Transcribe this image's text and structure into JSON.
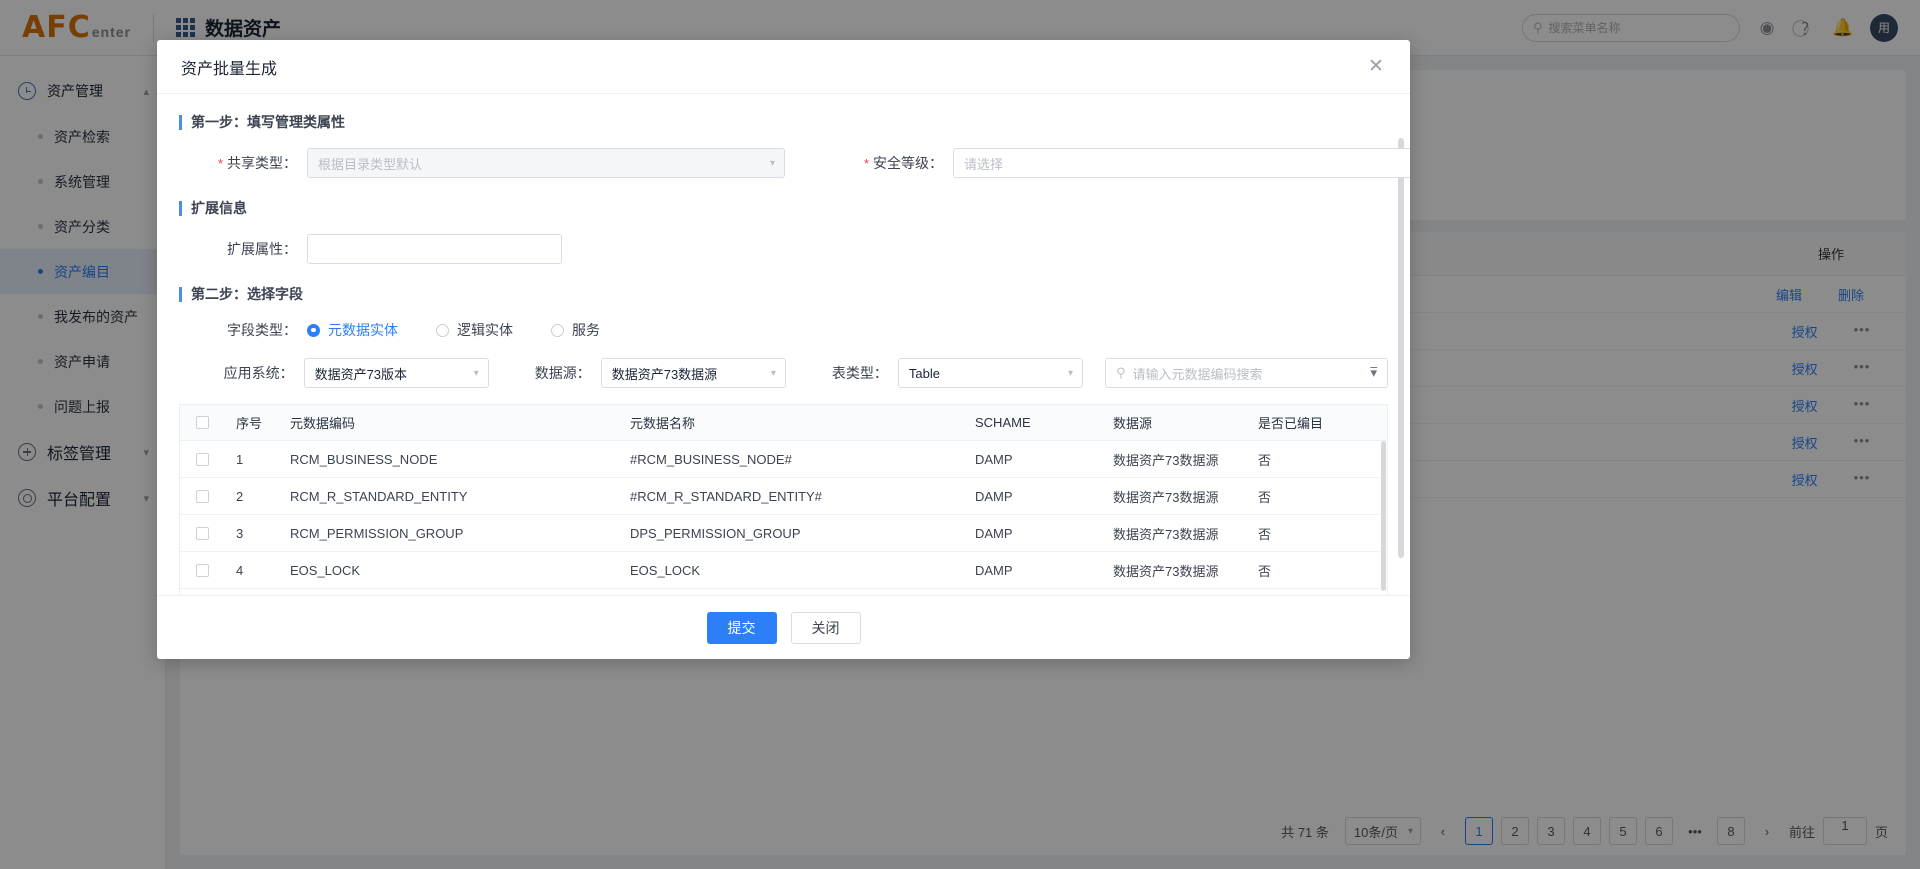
{
  "header": {
    "logo_main": "AFC",
    "logo_sub": "enter",
    "app_title": "数据资产",
    "search_placeholder": "搜索菜单名称",
    "avatar_text": "用"
  },
  "sidebar": {
    "groups": [
      {
        "label": "资产管理",
        "icon": "clock-icon",
        "expanded": true,
        "items": [
          {
            "label": "资产检索",
            "active": false
          },
          {
            "label": "系统管理",
            "active": false
          },
          {
            "label": "资产分类",
            "active": false
          },
          {
            "label": "资产编目",
            "active": true
          },
          {
            "label": "我发布的资产",
            "active": false
          },
          {
            "label": "资产申请",
            "active": false
          },
          {
            "label": "问题上报",
            "active": false
          }
        ]
      },
      {
        "label": "标签管理",
        "icon": "plus-circle-icon",
        "expanded": false,
        "items": []
      },
      {
        "label": "平台配置",
        "icon": "gear-icon",
        "expanded": false,
        "items": []
      }
    ]
  },
  "background": {
    "table_header_op": "操作",
    "rows": [
      {
        "edit": "编辑",
        "delete": "删除",
        "auth": "",
        "dots": ""
      },
      {
        "edit": "",
        "delete": "",
        "auth": "授权",
        "dots": "•••"
      },
      {
        "edit": "",
        "delete": "",
        "auth": "授权",
        "dots": "•••"
      },
      {
        "edit": "",
        "delete": "",
        "auth": "授权",
        "dots": "•••"
      },
      {
        "edit": "",
        "delete": "",
        "auth": "授权",
        "dots": "•••"
      },
      {
        "edit": "",
        "delete": "",
        "auth": "授权",
        "dots": "•••"
      }
    ],
    "pagination": {
      "total_text": "共 71 条",
      "page_size": "10条/页",
      "prev": "‹",
      "next": "›",
      "pages": [
        "1",
        "2",
        "3",
        "4",
        "5",
        "6",
        "•••",
        "8"
      ],
      "current": "1",
      "goto_label": "前往",
      "goto_value": "1",
      "page_unit": "页"
    }
  },
  "modal": {
    "title": "资产批量生成",
    "close_icon": "close-icon",
    "step1": {
      "heading": "第一步：填写管理类属性",
      "share_type": {
        "label": "共享类型：",
        "required": true,
        "value": "根据目录类型默认",
        "caret": "chevron-down-icon"
      },
      "security_level": {
        "label": "安全等级：",
        "required": true,
        "placeholder": "请选择",
        "value": "",
        "caret": "chevron-down-icon"
      }
    },
    "extension": {
      "heading": "扩展信息",
      "attr": {
        "label": "扩展属性：",
        "value": "",
        "placeholder": ""
      }
    },
    "step2": {
      "heading": "第二步：选择字段",
      "field_type": {
        "label": "字段类型：",
        "options": [
          {
            "label": "元数据实体",
            "checked": true
          },
          {
            "label": "逻辑实体",
            "checked": false
          },
          {
            "label": "服务",
            "checked": false
          }
        ]
      },
      "filters": {
        "app_system": {
          "label": "应用系统：",
          "value": "数据资产73版本"
        },
        "data_source": {
          "label": "数据源：",
          "value": "数据资产73数据源"
        },
        "table_type": {
          "label": "表类型：",
          "value": "Table"
        },
        "search": {
          "placeholder": "请输入元数据编码搜索",
          "value": "",
          "icon": "search-icon",
          "filter_icon": "funnel-icon"
        }
      },
      "table": {
        "columns": [
          "",
          "序号",
          "元数据编码",
          "元数据名称",
          "SCHAME",
          "数据源",
          "是否已编目"
        ],
        "rows": [
          {
            "idx": "1",
            "code": "RCM_BUSINESS_NODE",
            "name": "#RCM_BUSINESS_NODE#",
            "schema": "DAMP",
            "source": "数据资产73数据源",
            "cataloged": "否"
          },
          {
            "idx": "2",
            "code": "RCM_R_STANDARD_ENTITY",
            "name": "#RCM_R_STANDARD_ENTITY#",
            "schema": "DAMP",
            "source": "数据资产73数据源",
            "cataloged": "否"
          },
          {
            "idx": "3",
            "code": "RCM_PERMISSION_GROUP",
            "name": "DPS_PERMISSION_GROUP",
            "schema": "DAMP",
            "source": "数据资产73数据源",
            "cataloged": "否"
          },
          {
            "idx": "4",
            "code": "EOS_LOCK",
            "name": "EOS_LOCK",
            "schema": "DAMP",
            "source": "数据资产73数据源",
            "cataloged": "否"
          }
        ]
      }
    },
    "footer": {
      "submit": "提交",
      "close": "关闭"
    }
  },
  "colors": {
    "accent": "#2d7ff9",
    "brand_orange": "#d9740c",
    "required_red": "#e9434a",
    "section_bar": "#4a90e2"
  }
}
